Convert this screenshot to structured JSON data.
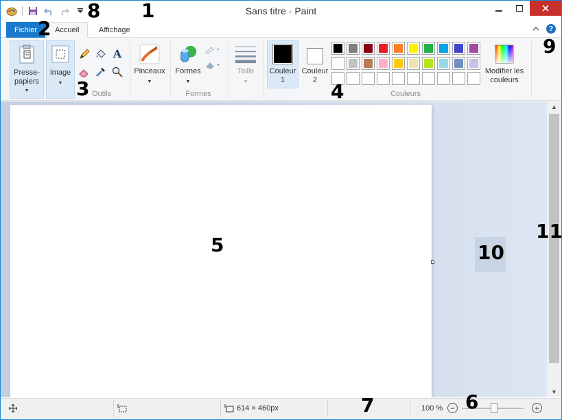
{
  "window": {
    "title": "Sans titre - Paint"
  },
  "tabs": {
    "file": "Fichier",
    "home": "Accueil",
    "view": "Affichage"
  },
  "ribbon": {
    "clipboard": {
      "label1": "Presse-",
      "label2": "papiers"
    },
    "image": {
      "label": "Image"
    },
    "tools": {
      "group_label": "Outils"
    },
    "brushes": {
      "label": "Pinceaux"
    },
    "shapes": {
      "label": "Formes",
      "group_label": "Formes"
    },
    "size": {
      "label": "Taille"
    },
    "color1": {
      "label1": "Couleur",
      "label2": "1"
    },
    "color2": {
      "label1": "Couleur",
      "label2": "2"
    },
    "colors_group_label": "Couleurs",
    "edit_colors": {
      "label1": "Modifier les",
      "label2": "couleurs"
    }
  },
  "palette": {
    "row1": [
      "#000000",
      "#7f7f7f",
      "#880015",
      "#ed1c24",
      "#ff7f27",
      "#fff200",
      "#22b14c",
      "#00a2e8",
      "#3f48cc",
      "#a349a4"
    ],
    "row2": [
      "#ffffff",
      "#c3c3c3",
      "#b97a57",
      "#ffaec9",
      "#ffc90e",
      "#efe4b0",
      "#b5e61d",
      "#99d9ea",
      "#7092be",
      "#c8bfe7"
    ],
    "row3": [
      "#ffffff",
      "#ffffff",
      "#ffffff",
      "#ffffff",
      "#ffffff",
      "#ffffff",
      "#ffffff",
      "#ffffff",
      "#ffffff",
      "#ffffff"
    ]
  },
  "status": {
    "dimensions": "614 × 460px",
    "zoom": "100 %"
  },
  "callouts": {
    "n1": "1",
    "n2": "2",
    "n3": "3",
    "n4": "4",
    "n5": "5",
    "n6": "6",
    "n7": "7",
    "n8": "8",
    "n9": "9",
    "n10": "10",
    "n11": "11"
  }
}
